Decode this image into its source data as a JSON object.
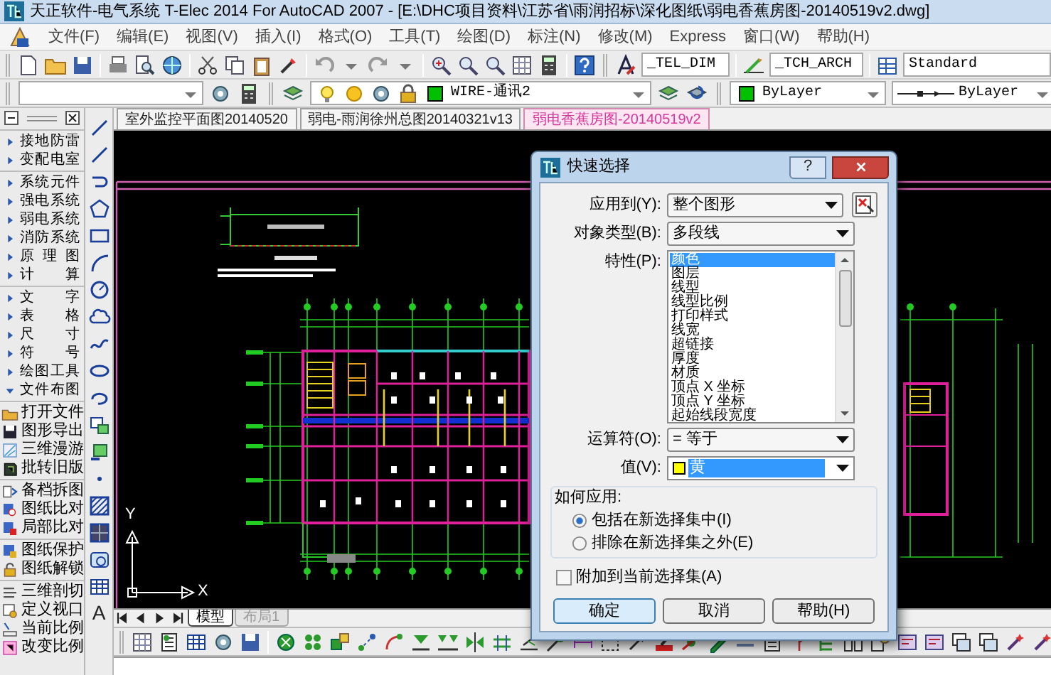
{
  "window": {
    "title": "天正软件-电气系统 T-Elec 2014  For AutoCAD 2007 - [E:\\DHC项目资料\\江苏省\\雨润招标\\深化图纸\\弱电香蕉房图-20140519v2.dwg]"
  },
  "menu": [
    "文件(F)",
    "编辑(E)",
    "视图(V)",
    "插入(I)",
    "格式(O)",
    "工具(T)",
    "绘图(D)",
    "标注(N)",
    "修改(M)",
    "Express",
    "窗口(W)",
    "帮助(H)"
  ],
  "toolbar_1": {
    "text_style": "_TEL_DIM",
    "dim_style": "_TCH_ARCH",
    "table_style": "Standard"
  },
  "toolbar_2": {
    "layer": "WIRE-通讯2",
    "color_setting": "ByLayer",
    "linetype": "ByLayer"
  },
  "document_tabs": [
    {
      "label": "室外监控平面图20140520",
      "selected": false
    },
    {
      "label": "弱电-雨润徐州总图20140321v13",
      "selected": false
    },
    {
      "label": "弱电香蕉房图-20140519v2",
      "selected": true
    }
  ],
  "side_panel": {
    "groups": [
      {
        "items": [
          {
            "label": "接地防雷",
            "expanded": false
          },
          {
            "label": "变配电室",
            "expanded": false
          }
        ]
      },
      {
        "items": [
          {
            "label": "系统元件",
            "expanded": false
          },
          {
            "label": "强电系统",
            "expanded": false
          },
          {
            "label": "弱电系统",
            "expanded": false
          },
          {
            "label": "消防系统",
            "expanded": false
          },
          {
            "label": "原 理 图",
            "expanded": false
          },
          {
            "label": "计 算",
            "expanded": false
          }
        ]
      },
      {
        "items": [
          {
            "label": "文 字",
            "expanded": false
          },
          {
            "label": "表 格",
            "expanded": false
          },
          {
            "label": "尺 寸",
            "expanded": false
          },
          {
            "label": "符 号",
            "expanded": false
          },
          {
            "label": "绘图工具",
            "expanded": false
          },
          {
            "label": "文件布图",
            "expanded": true
          }
        ]
      }
    ],
    "tool_groups": [
      [
        "打开文件",
        "图形导出",
        "三维漫游",
        "批转旧版"
      ],
      [
        "备档拆图",
        "图纸比对",
        "局部比对"
      ],
      [
        "图纸保护",
        "图纸解锁"
      ],
      [
        "三维剖切",
        "定义视口",
        "当前比例",
        "改变比例"
      ]
    ]
  },
  "draw_toolbar": {
    "text_tool": "A"
  },
  "canvas": {
    "ucs": {
      "x_label": "X",
      "y_label": "Y"
    }
  },
  "layout_tabs": [
    {
      "label": "模型",
      "selected": true
    },
    {
      "label": "布局1",
      "selected": false
    }
  ],
  "dialog": {
    "title": "快速选择",
    "help_button": "?",
    "fields": [
      {
        "kind": "dropdown",
        "label": "应用到(Y):",
        "value": "整个图形"
      },
      {
        "kind": "dropdown",
        "label": "对象类型(B):",
        "value": "多段线"
      },
      {
        "kind": "list",
        "label": "特性(P):",
        "items": [
          {
            "label": "颜色",
            "selected": true
          },
          {
            "label": "图层",
            "selected": false
          },
          {
            "label": "线型",
            "selected": false
          },
          {
            "label": "线型比例",
            "selected": false
          },
          {
            "label": "打印样式",
            "selected": false
          },
          {
            "label": "线宽",
            "selected": false
          },
          {
            "label": "超链接",
            "selected": false
          },
          {
            "label": "厚度",
            "selected": false
          },
          {
            "label": "材质",
            "selected": false
          },
          {
            "label": "顶点 X 坐标",
            "selected": false
          },
          {
            "label": "顶点 Y 坐标",
            "selected": false
          },
          {
            "label": "起始线段宽度",
            "selected": false
          }
        ]
      },
      {
        "kind": "dropdown",
        "label": "运算符(O):",
        "value": "= 等于"
      },
      {
        "kind": "color_dropdown",
        "label": "值(V):",
        "value": "黄",
        "color": "#ffff00"
      }
    ],
    "how_to_apply": {
      "label": "如何应用:",
      "options": [
        {
          "label": "包括在新选择集中(I)",
          "selected": true
        },
        {
          "label": "排除在新选择集之外(E)",
          "selected": false
        }
      ]
    },
    "append": {
      "label": "附加到当前选择集(A)",
      "checked": false
    },
    "buttons": [
      {
        "label": "确定",
        "default": true
      },
      {
        "label": "取消",
        "default": false
      },
      {
        "label": "帮助(H)",
        "default": false
      }
    ]
  }
}
